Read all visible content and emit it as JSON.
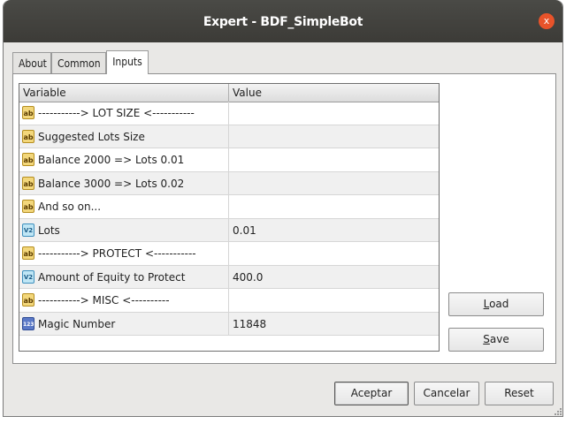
{
  "window": {
    "title": "Expert - BDF_SimpleBot",
    "close_glyph": "x"
  },
  "tabs": [
    {
      "label": "About",
      "active": false
    },
    {
      "label": "Common",
      "active": false
    },
    {
      "label": "Inputs",
      "active": true
    }
  ],
  "grid": {
    "columns": {
      "variable": "Variable",
      "value": "Value"
    },
    "rows": [
      {
        "type": "string",
        "icon": "ab",
        "name": "-----------> LOT SIZE <-----------",
        "value": ""
      },
      {
        "type": "string",
        "icon": "ab",
        "name": "Suggested Lots Size",
        "value": ""
      },
      {
        "type": "string",
        "icon": "ab",
        "name": "Balance 2000 => Lots 0.01",
        "value": ""
      },
      {
        "type": "string",
        "icon": "ab",
        "name": "Balance 3000 => Lots 0.02",
        "value": ""
      },
      {
        "type": "string",
        "icon": "ab",
        "name": "And so on...",
        "value": ""
      },
      {
        "type": "double",
        "icon": "V2",
        "name": "Lots",
        "value": "0.01"
      },
      {
        "type": "string",
        "icon": "ab",
        "name": "-----------> PROTECT  <-----------",
        "value": ""
      },
      {
        "type": "double",
        "icon": "V2",
        "name": "Amount of Equity to Protect",
        "value": "400.0"
      },
      {
        "type": "string",
        "icon": "ab",
        "name": "-----------> MISC   <----------",
        "value": ""
      },
      {
        "type": "int",
        "icon": "123",
        "name": "Magic Number",
        "value": "11848"
      }
    ]
  },
  "side_buttons": {
    "load": "Load",
    "save": "Save"
  },
  "footer_buttons": {
    "accept": "Aceptar",
    "cancel": "Cancelar",
    "reset": "Reset"
  }
}
